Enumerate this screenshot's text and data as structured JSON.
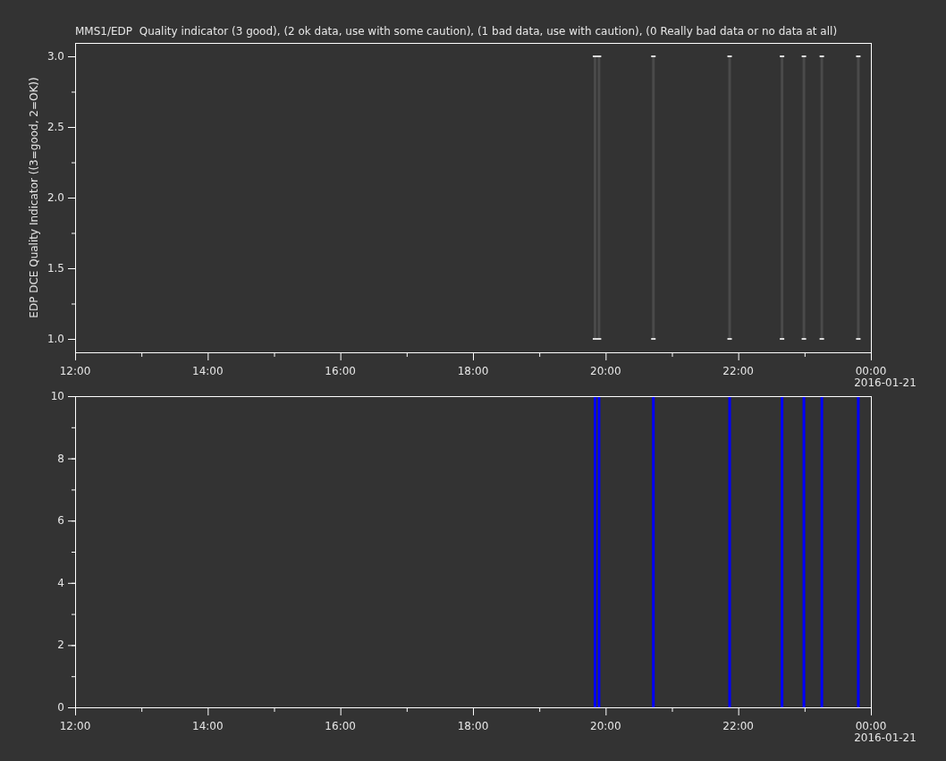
{
  "title": "MMS1/EDP  Quality indicator (3 good), (2 ok data, use with some caution), (1 bad data, use with caution), (0 Really bad data or no data at all)",
  "charts": [
    {
      "date_label": "2016-01-21",
      "chart_data": {
        "type": "scatter",
        "ylabel": "EDP DCE Quality Indicator ((3=good, 2=OK))",
        "x": [
          19.84,
          19.9,
          20.72,
          21.87,
          22.66,
          22.99,
          23.26,
          23.81
        ],
        "series": [
          {
            "color": "#dddddd",
            "values": [
              3,
              3,
              3,
              3,
              3,
              3,
              3,
              3
            ]
          },
          {
            "color": "#dddddd",
            "values": [
              1,
              1,
              1,
              1,
              1,
              1,
              1,
              1
            ]
          }
        ],
        "xlim": [
          12,
          24
        ],
        "ylim": [
          0.905,
          3.095
        ],
        "xticks": [
          {
            "value": 12,
            "label": "12:00"
          },
          {
            "value": 14,
            "label": "14:00"
          },
          {
            "value": 16,
            "label": "16:00"
          },
          {
            "value": 18,
            "label": "18:00"
          },
          {
            "value": 20,
            "label": "20:00"
          },
          {
            "value": 22,
            "label": "22:00"
          },
          {
            "value": 24,
            "label": "00:00"
          }
        ],
        "yticks": [
          {
            "value": 1,
            "label": "1.0"
          },
          {
            "value": 1.5,
            "label": "1.5"
          },
          {
            "value": 2,
            "label": "2.0"
          },
          {
            "value": 2.5,
            "label": "2.5"
          },
          {
            "value": 3,
            "label": "3.0"
          }
        ]
      }
    },
    {
      "date_label": "2016-01-21",
      "chart_data": {
        "type": "bar",
        "x": [
          19.84,
          19.9,
          20.72,
          21.87,
          22.66,
          22.99,
          23.26,
          23.81
        ],
        "series": [
          {
            "color": "#0000ff",
            "values": [
              10,
              10,
              10,
              10,
              10,
              10,
              10,
              10
            ]
          }
        ],
        "xlim": [
          12,
          24
        ],
        "ylim": [
          0,
          10
        ],
        "xticks": [
          {
            "value": 12,
            "label": "12:00"
          },
          {
            "value": 14,
            "label": "14:00"
          },
          {
            "value": 16,
            "label": "16:00"
          },
          {
            "value": 18,
            "label": "18:00"
          },
          {
            "value": 20,
            "label": "20:00"
          },
          {
            "value": 22,
            "label": "22:00"
          },
          {
            "value": 24,
            "label": "00:00"
          }
        ],
        "yticks": [
          {
            "value": 0,
            "label": "0"
          },
          {
            "value": 2,
            "label": "2"
          },
          {
            "value": 4,
            "label": "4"
          },
          {
            "value": 6,
            "label": "6"
          },
          {
            "value": 8,
            "label": "8"
          },
          {
            "value": 10,
            "label": "10"
          }
        ]
      }
    }
  ]
}
